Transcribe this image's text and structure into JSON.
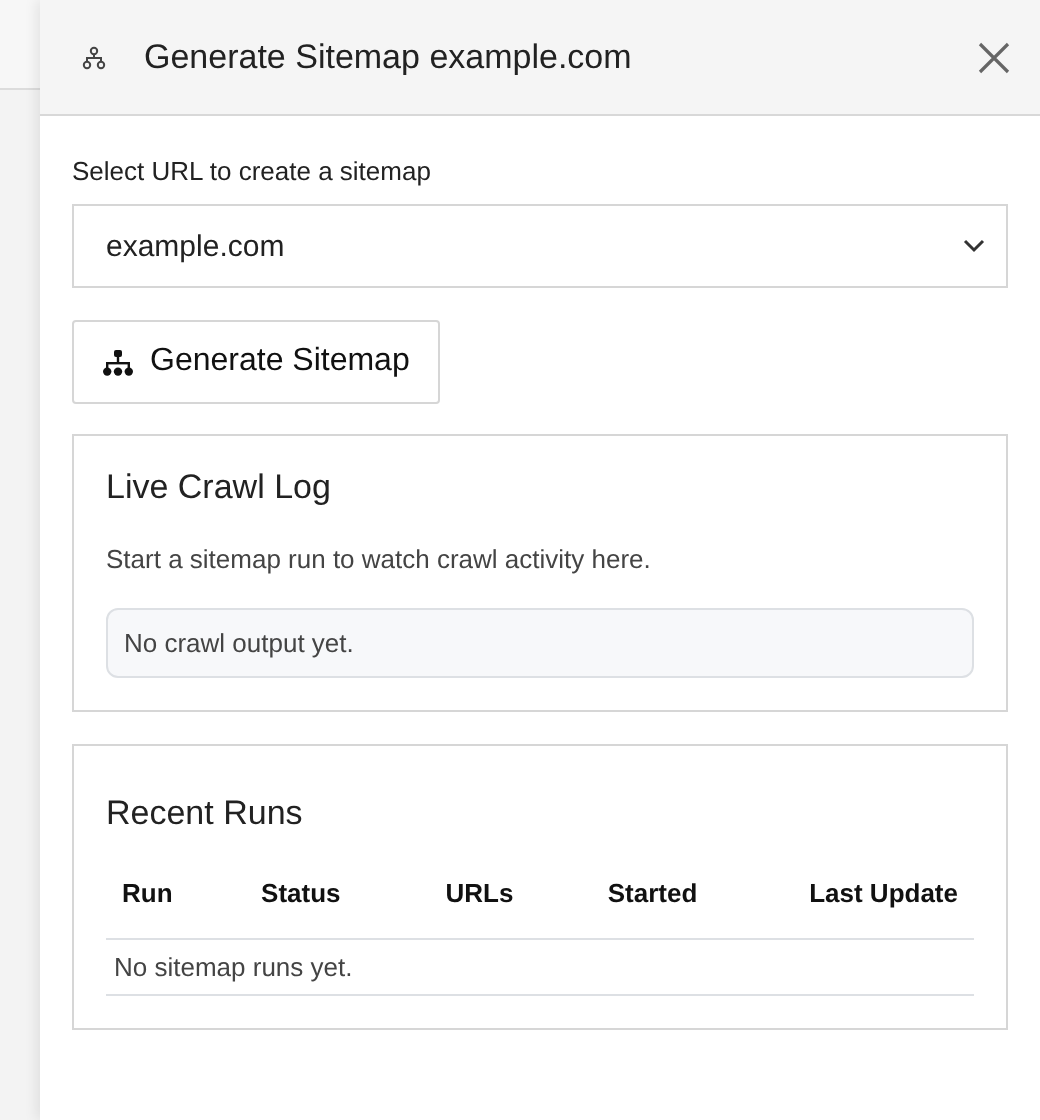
{
  "panel": {
    "title": "Generate Sitemap example.com"
  },
  "url_select": {
    "label": "Select URL to create a sitemap",
    "value": "example.com"
  },
  "generate_button": {
    "label": "Generate Sitemap"
  },
  "crawl_log": {
    "title": "Live Crawl Log",
    "description": "Start a sitemap run to watch crawl activity here.",
    "output": "No crawl output yet."
  },
  "recent_runs": {
    "title": "Recent Runs",
    "columns": [
      "Run",
      "Status",
      "URLs",
      "Started",
      "Last Update"
    ],
    "empty_message": "No sitemap runs yet."
  }
}
